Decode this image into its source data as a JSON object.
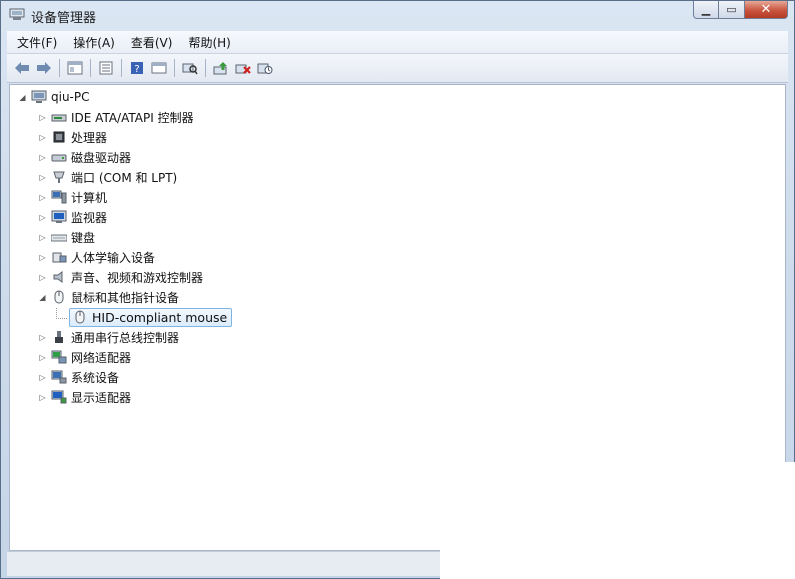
{
  "window": {
    "title": "设备管理器"
  },
  "menu": [
    "文件(F)",
    "操作(A)",
    "查看(V)",
    "帮助(H)"
  ],
  "toolbar_icons": [
    "back-icon",
    "forward-icon",
    "properties-pane-icon",
    "list-icon",
    "help-icon",
    "view-icon",
    "scan-hardware-icon",
    "update-driver-icon",
    "uninstall-icon",
    "disable-icon"
  ],
  "tree": {
    "root": "qiu-PC",
    "categories": [
      {
        "label": "IDE ATA/ATAPI 控制器",
        "icon": "ide-icon"
      },
      {
        "label": "处理器",
        "icon": "cpu-icon"
      },
      {
        "label": "磁盘驱动器",
        "icon": "disk-icon"
      },
      {
        "label": "端口 (COM 和 LPT)",
        "icon": "port-icon"
      },
      {
        "label": "计算机",
        "icon": "computer-icon"
      },
      {
        "label": "监视器",
        "icon": "monitor-icon"
      },
      {
        "label": "键盘",
        "icon": "keyboard-icon"
      },
      {
        "label": "人体学输入设备",
        "icon": "hid-icon"
      },
      {
        "label": "声音、视频和游戏控制器",
        "icon": "speaker-icon"
      },
      {
        "label": "鼠标和其他指针设备",
        "icon": "mouse-icon",
        "expanded": true,
        "children": [
          {
            "label": "HID-compliant mouse",
            "icon": "mouse-icon",
            "selected": true
          }
        ]
      },
      {
        "label": "通用串行总线控制器",
        "icon": "usb-icon"
      },
      {
        "label": "网络适配器",
        "icon": "network-icon"
      },
      {
        "label": "系统设备",
        "icon": "system-icon"
      },
      {
        "label": "显示适配器",
        "icon": "display-icon"
      }
    ]
  }
}
